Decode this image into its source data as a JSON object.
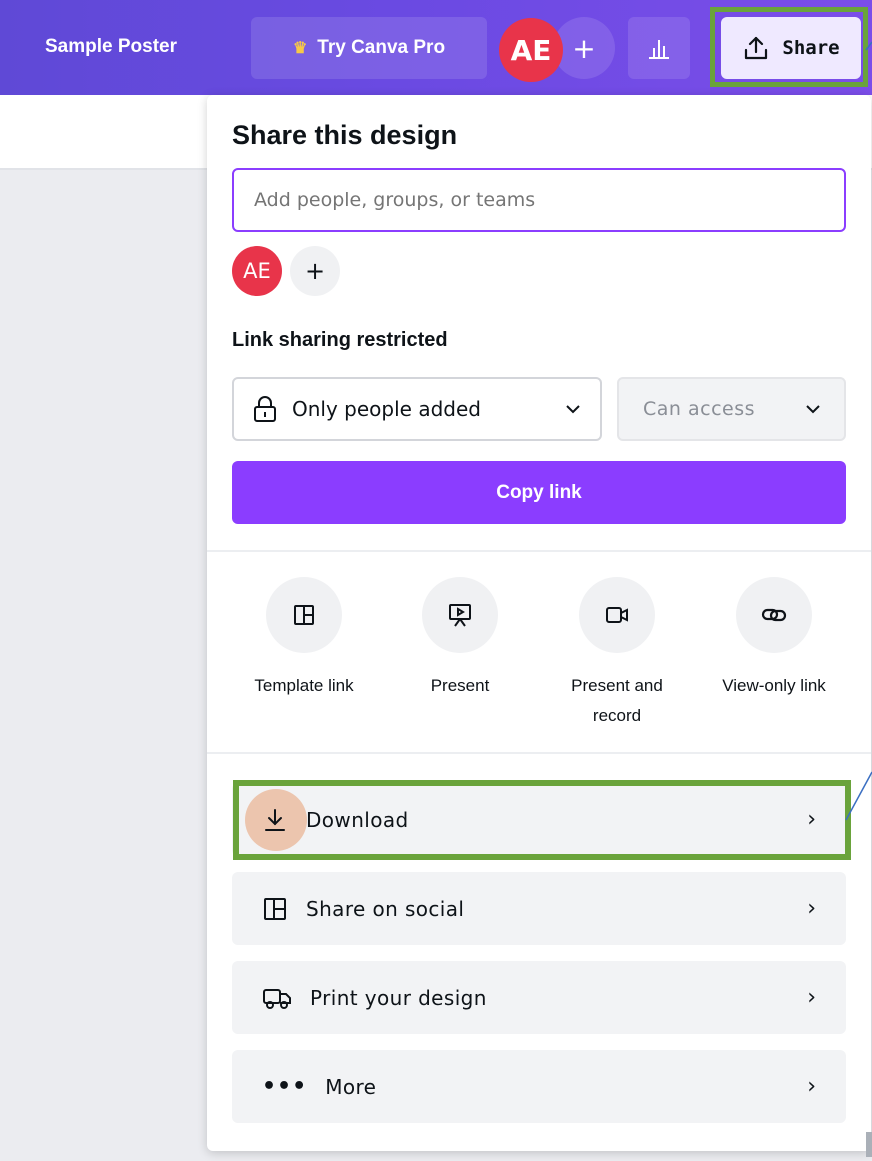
{
  "topbar": {
    "design_title": "Sample Poster",
    "pro_button": "Try Canva Pro",
    "avatar_initials": "AE",
    "share_button": "Share"
  },
  "share_panel": {
    "title": "Share this design",
    "people_input": {
      "placeholder": "Add people, groups, or teams",
      "value": ""
    },
    "collaborator_initials": "AE",
    "link_heading": "Link sharing restricted",
    "access_select": "Only people added",
    "permission_select": "Can access",
    "copy_link_button": "Copy link",
    "quick_actions": [
      {
        "label": "Template link",
        "icon": "template-icon"
      },
      {
        "label": "Present",
        "icon": "present-icon"
      },
      {
        "label": "Present and record",
        "icon": "record-icon"
      },
      {
        "label": "View-only link",
        "icon": "link-icon"
      }
    ],
    "options": [
      {
        "label": "Download",
        "icon": "download-icon",
        "highlighted": true
      },
      {
        "label": "Share on social",
        "icon": "social-icon"
      },
      {
        "label": "Print your design",
        "icon": "truck-icon"
      },
      {
        "label": "More",
        "icon": "more-icon"
      }
    ]
  },
  "colors": {
    "brand_purple": "#8b3dff",
    "avatar_red": "#e8344a",
    "highlight_green": "#6aa33b"
  }
}
